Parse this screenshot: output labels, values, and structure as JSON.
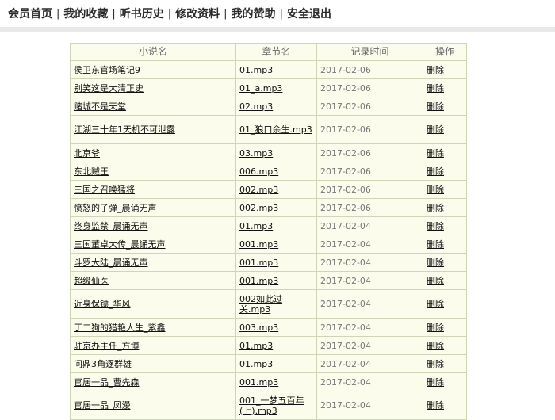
{
  "nav": {
    "items": [
      "会员首页",
      "我的收藏",
      "听书历史",
      "修改资料",
      "我的赞助",
      "安全退出"
    ],
    "separator": "|"
  },
  "table": {
    "headers": [
      "小说名",
      "章节名",
      "记录时间",
      "操作"
    ],
    "rows": [
      {
        "title": "侯卫东官场笔记9",
        "chapter": "01.mp3",
        "time": "2017-02-06",
        "action": "删除"
      },
      {
        "title": "别笑这是大清正史",
        "chapter": "01_a.mp3",
        "time": "2017-02-06",
        "action": "删除"
      },
      {
        "title": "赌城不是天堂",
        "chapter": "02.mp3",
        "time": "2017-02-06",
        "action": "删除"
      },
      {
        "title": "江湖三十年1天机不可泄露",
        "chapter": "01_狼口余生.mp3",
        "time": "2017-02-06",
        "action": "删除"
      },
      {
        "title": "北京爷",
        "chapter": "03.mp3",
        "time": "2017-02-06",
        "action": "删除"
      },
      {
        "title": "东北贼王",
        "chapter": "006.mp3",
        "time": "2017-02-06",
        "action": "删除"
      },
      {
        "title": "三国之召唤猛将",
        "chapter": "002.mp3",
        "time": "2017-02-06",
        "action": "删除"
      },
      {
        "title": "愤怒的子弹_晨诵无声",
        "chapter": "002.mp3",
        "time": "2017-02-06",
        "action": "删除"
      },
      {
        "title": "终身监禁_晨诵无声",
        "chapter": "01.mp3",
        "time": "2017-02-04",
        "action": "删除"
      },
      {
        "title": "三国董卓大传_晨诵无声",
        "chapter": "001.mp3",
        "time": "2017-02-04",
        "action": "删除"
      },
      {
        "title": "斗罗大陆_晨诵无声",
        "chapter": "001.mp3",
        "time": "2017-02-04",
        "action": "删除"
      },
      {
        "title": "超级仙医",
        "chapter": "001.mp3",
        "time": "2017-02-04",
        "action": "删除"
      },
      {
        "title": "近身保镖_华风",
        "chapter": "002如此过关.mp3",
        "time": "2017-02-04",
        "action": "删除"
      },
      {
        "title": "丁二狗的猎艳人生_紫鑫",
        "chapter": "003.mp3",
        "time": "2017-02-04",
        "action": "删除"
      },
      {
        "title": "驻京办主任_方博",
        "chapter": "01.mp3",
        "time": "2017-02-04",
        "action": "删除"
      },
      {
        "title": "问鼎3角逐群雄",
        "chapter": "01.mp3",
        "time": "2017-02-04",
        "action": "删除"
      },
      {
        "title": "官居一品_曹先森",
        "chapter": "001.mp3",
        "time": "2017-02-04",
        "action": "删除"
      },
      {
        "title": "官居一品_凤漫",
        "chapter": "001_一梦五百年(上).mp3",
        "time": "2017-02-04",
        "action": "删除"
      }
    ]
  }
}
